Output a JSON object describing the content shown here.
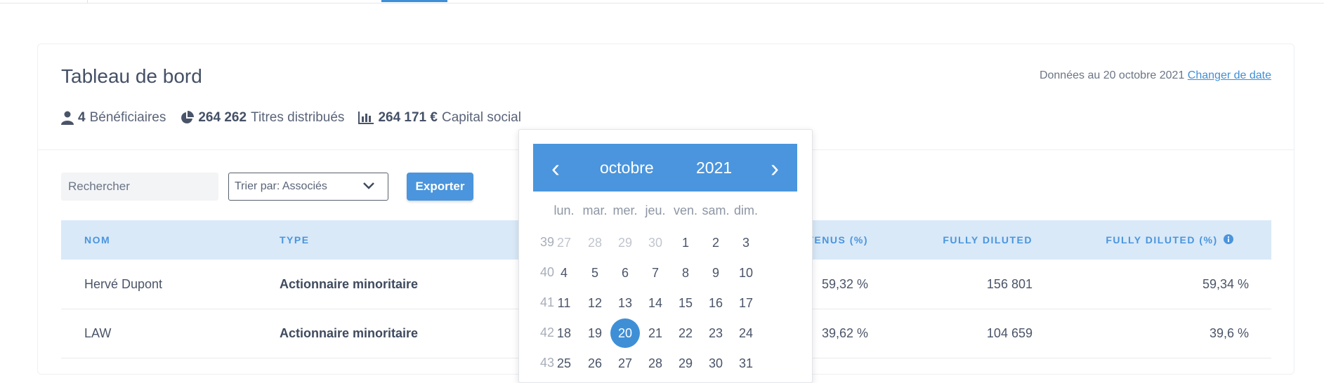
{
  "dashboard": {
    "title": "Tableau de bord",
    "date_text": "Données au 20 octobre 2021",
    "change_date_link": "Changer de date"
  },
  "stats": [
    {
      "icon": "user-icon",
      "value": "4",
      "label": "Bénéficiaires"
    },
    {
      "icon": "pie-chart-icon",
      "value": "264 262",
      "label": "Titres distribués"
    },
    {
      "icon": "bar-chart-icon",
      "value": "264 171 €",
      "label": "Capital social"
    }
  ],
  "toolbar": {
    "search_placeholder": "Rechercher",
    "sort_label": "Trier par: Associés",
    "export_label": "Exporter"
  },
  "table": {
    "headers": {
      "name": "NOM",
      "type": "TYPE",
      "held_pct": "TENUS (%)",
      "fully_diluted": "FULLY DILUTED",
      "fully_diluted_pct": "FULLY DILUTED (%)"
    },
    "rows": [
      {
        "name": "Hervé Dupont",
        "type": "Actionnaire minoritaire",
        "held_pct": "59,32 %",
        "fully_diluted": "156 801",
        "fully_diluted_pct": "59,34 %"
      },
      {
        "name": "LAW",
        "type": "Actionnaire minoritaire",
        "held_pct": "39,62 %",
        "fully_diluted": "104 659",
        "fully_diluted_pct": "39,6 %"
      }
    ]
  },
  "calendar": {
    "prev_label": "‹",
    "next_label": "›",
    "month": "octobre",
    "year": "2021",
    "weekdays": [
      "lun.",
      "mar.",
      "mer.",
      "jeu.",
      "ven.",
      "sam.",
      "dim."
    ],
    "weeks": [
      {
        "num": "39",
        "days": [
          "27",
          "28",
          "29",
          "30",
          "1",
          "2",
          "3"
        ],
        "muted": [
          true,
          true,
          true,
          true,
          false,
          false,
          false
        ]
      },
      {
        "num": "40",
        "days": [
          "4",
          "5",
          "6",
          "7",
          "8",
          "9",
          "10"
        ],
        "muted": [
          false,
          false,
          false,
          false,
          false,
          false,
          false
        ]
      },
      {
        "num": "41",
        "days": [
          "11",
          "12",
          "13",
          "14",
          "15",
          "16",
          "17"
        ],
        "muted": [
          false,
          false,
          false,
          false,
          false,
          false,
          false
        ]
      },
      {
        "num": "42",
        "days": [
          "18",
          "19",
          "20",
          "21",
          "22",
          "23",
          "24"
        ],
        "muted": [
          false,
          false,
          false,
          false,
          false,
          false,
          false
        ]
      },
      {
        "num": "43",
        "days": [
          "25",
          "26",
          "27",
          "28",
          "29",
          "30",
          "31"
        ],
        "muted": [
          false,
          false,
          false,
          false,
          false,
          false,
          false
        ]
      }
    ],
    "selected_day": "20",
    "accent_color": "#4a95dd"
  }
}
